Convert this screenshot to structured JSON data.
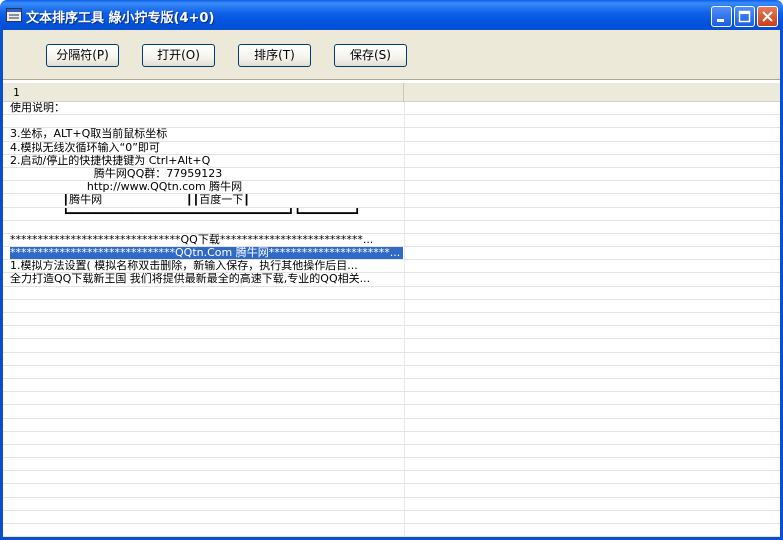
{
  "window": {
    "title": "文本排序工具 綠小拧专版(4+0)"
  },
  "toolbar": {
    "buttons": [
      {
        "label": "分隔符(P)"
      },
      {
        "label": "打开(O)"
      },
      {
        "label": "排序(T)"
      },
      {
        "label": "保存(S)"
      }
    ]
  },
  "list": {
    "columns": [
      "1",
      ""
    ],
    "rows": [
      "使用说明：",
      "",
      "3.坐标，ALT+Q取当前鼠标坐标",
      "4.模拟无线次循环输入“0”即可",
      "2.启动/停止的快捷快捷键为 Ctrl+Alt+Q",
      "                        腾牛网QQ群：77959123",
      "                      http://www.QQtn.com 腾牛网",
      "               ┃腾牛网                        ┃┃百度一下┃",
      "               ┗━━━━━━━━━━━━━━━━━━━━━━━━━━━━━━━━━┛┗━━━━━━━━┛",
      "",
      "*******************************QQ下载**************************...",
      "******************************QQtn.Com 腾牛网**********************...",
      "1.模拟方法设置( 模拟名称双击删除，新输入保存，执行其他操作后目...",
      "全力打造QQ下载新王国 我们将提供最新最全的高速下载,专业的QQ相关..."
    ],
    "selected_row_index": 11,
    "total_visible_rows": 33
  },
  "colors": {
    "titlebar": "#0a5ee8",
    "selection": "#316ac5",
    "toolbar_bg": "#ece9d8"
  }
}
